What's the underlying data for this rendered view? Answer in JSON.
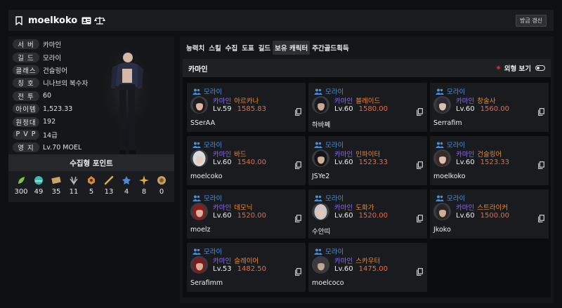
{
  "header": {
    "name": "moelkoko",
    "refresh_label": "방금 갱신"
  },
  "profile": {
    "rows": [
      {
        "label": "서 버",
        "value": "카마인"
      },
      {
        "label": "길 드",
        "value": "모라이"
      },
      {
        "label": "클래스",
        "value": "건슬링어"
      },
      {
        "label": "칭 호",
        "value": "니나브의 복수자"
      },
      {
        "label": "전 투",
        "value": "60"
      },
      {
        "label": "아이템",
        "value": "1,523.33"
      },
      {
        "label": "원정대",
        "value": "192"
      },
      {
        "label": "P V P",
        "value": "14급"
      },
      {
        "label": "영 지",
        "value": "Lv.70 MOEL"
      }
    ]
  },
  "collect": {
    "title": "수집형 포인트",
    "items": [
      {
        "icon": "mokoko-seed-icon",
        "value": "300",
        "color": "#7fc24a"
      },
      {
        "icon": "island-heart-icon",
        "value": "49",
        "color": "#3fb8b0"
      },
      {
        "icon": "masterpiece-icon",
        "value": "35",
        "color": "#c9a46a"
      },
      {
        "icon": "giant-heart-icon",
        "value": "11",
        "color": "#bbbbbb"
      },
      {
        "icon": "ignea-token-icon",
        "value": "5",
        "color": "#d08a3a"
      },
      {
        "icon": "voyage-item-icon",
        "value": "13",
        "color": "#d9b34a"
      },
      {
        "icon": "world-tree-leaf-icon",
        "value": "4",
        "color": "#4a8ad9"
      },
      {
        "icon": "orpheus-star-icon",
        "value": "8",
        "color": "#e0b040"
      },
      {
        "icon": "sailing-coin-icon",
        "value": "0",
        "color": "#caa060"
      }
    ]
  },
  "tabs": [
    {
      "label": "능력치",
      "active": false
    },
    {
      "label": "스킬",
      "active": false
    },
    {
      "label": "수집",
      "active": false
    },
    {
      "label": "도표",
      "active": false
    },
    {
      "label": "길드",
      "active": false
    },
    {
      "label": "보유 캐릭터",
      "active": true
    },
    {
      "label": "주간골드획득",
      "active": false
    }
  ],
  "roster": {
    "server_title": "카마인",
    "view_label": "외형 보기",
    "cards": [
      {
        "guild": "모라이",
        "server": "카마인",
        "class": "아르카나",
        "level": "Lv.59",
        "item_level": "1585.83",
        "name": "SSerAA",
        "hair": "#1e1a1d",
        "skin": "#d9b7a4"
      },
      {
        "guild": "모라이",
        "server": "카마인",
        "class": "블레이드",
        "level": "Lv.60",
        "item_level": "1580.00",
        "name": "하바쩨",
        "hair": "#1a1a1e",
        "skin": "#c9a892"
      },
      {
        "guild": "모라이",
        "server": "카마인",
        "class": "창술사",
        "level": "Lv.60",
        "item_level": "1560.00",
        "name": "Serrafim",
        "hair": "#2a2a30",
        "skin": "#d8c0b0"
      },
      {
        "guild": "모라이",
        "server": "카마인",
        "class": "바드",
        "level": "Lv.60",
        "item_level": "1540.00",
        "name": "moelcoko",
        "hair": "#d9dcdf",
        "skin": "#e4cbbb"
      },
      {
        "guild": "모라이",
        "server": "카마인",
        "class": "인파이터",
        "level": "Lv.60",
        "item_level": "1523.33",
        "name": "JSYe2",
        "hair": "#141416",
        "skin": "#cfae98"
      },
      {
        "guild": "모라이",
        "server": "카마인",
        "class": "건슬링어",
        "level": "Lv.60",
        "item_level": "1523.33",
        "name": "moelkoko",
        "hair": "#3a2a25",
        "skin": "#dcbfae"
      },
      {
        "guild": "모라이",
        "server": "카마인",
        "class": "데모닉",
        "level": "Lv.60",
        "item_level": "1520.00",
        "name": "moelz",
        "hair": "#8a1d20",
        "skin": "#d8b3a0"
      },
      {
        "guild": "모라이",
        "server": "카마인",
        "class": "도화가",
        "level": "Lv.60",
        "item_level": "1520.00",
        "name": "수안띠",
        "hair": "#cfc8c6",
        "skin": "#e2c8b8"
      },
      {
        "guild": "모라이",
        "server": "카마인",
        "class": "스트라이커",
        "level": "Lv.60",
        "item_level": "1500.00",
        "name": "Jkoko",
        "hair": "#2a2324",
        "skin": "#cfae99"
      },
      {
        "guild": "모라이",
        "server": "카마인",
        "class": "슬레이어",
        "level": "Lv.53",
        "item_level": "1482.50",
        "name": "Serafimm",
        "hair": "#7a1a1e",
        "skin": "#d6b09c"
      },
      {
        "guild": "모라이",
        "server": "카마인",
        "class": "스카우터",
        "level": "Lv.60",
        "item_level": "1475.00",
        "name": "moelcoco",
        "hair": "#3a3a3e",
        "skin": "#bda592"
      }
    ]
  },
  "colors": {
    "guild": "#4a90d9",
    "server": "#8a6cf0",
    "class": "#f0882c",
    "item_level": "#f0683c",
    "view_star": "#e0262f"
  }
}
